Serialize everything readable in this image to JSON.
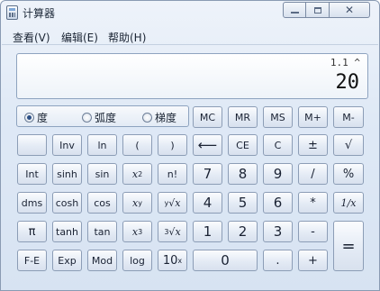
{
  "window": {
    "title": "计算器",
    "close_symbol": "✕"
  },
  "menu": {
    "items": [
      "查看(V)",
      "编辑(E)",
      "帮助(H)"
    ]
  },
  "display": {
    "expression": "1.1 ^",
    "value": "20"
  },
  "angle": {
    "options": [
      "度",
      "弧度",
      "梯度"
    ],
    "selected": "度"
  },
  "buttons": {
    "mc": "MC",
    "mr": "MR",
    "ms": "MS",
    "mplus": "M+",
    "mminus": "M-",
    "inv": "Inv",
    "ln": "ln",
    "lparen": "(",
    "rparen": ")",
    "backspace": "⟵",
    "ce": "CE",
    "c": "C",
    "plusminus": "±",
    "sqrt": "√",
    "int": "Int",
    "sinh": "sinh",
    "sin": "sin",
    "x2": "x",
    "x2_sup": "2",
    "factorial": "n!",
    "n7": "7",
    "n8": "8",
    "n9": "9",
    "divide": "/",
    "percent": "%",
    "dms": "dms",
    "cosh": "cosh",
    "cos": "cos",
    "xy": "x",
    "xy_sup": "y",
    "yroot": "∜x",
    "yroot_index": "y",
    "yroot_radical": "√",
    "yroot_x": "x",
    "n4": "4",
    "n5": "5",
    "n6": "6",
    "multiply": "*",
    "reciprocal": "1/x",
    "pi": "π",
    "tanh": "tanh",
    "tan": "tan",
    "x3": "x",
    "x3_sup": "3",
    "cuberoot_index": "3",
    "cuberoot_radical": "√",
    "cuberoot_x": "x",
    "n1": "1",
    "n2": "2",
    "n3": "3",
    "minus": "-",
    "equals": "=",
    "fe": "F-E",
    "exp": "Exp",
    "mod": "Mod",
    "log": "log",
    "tenx": "10",
    "tenx_sup": "x",
    "n0": "0",
    "dot": ".",
    "plus": "+"
  }
}
